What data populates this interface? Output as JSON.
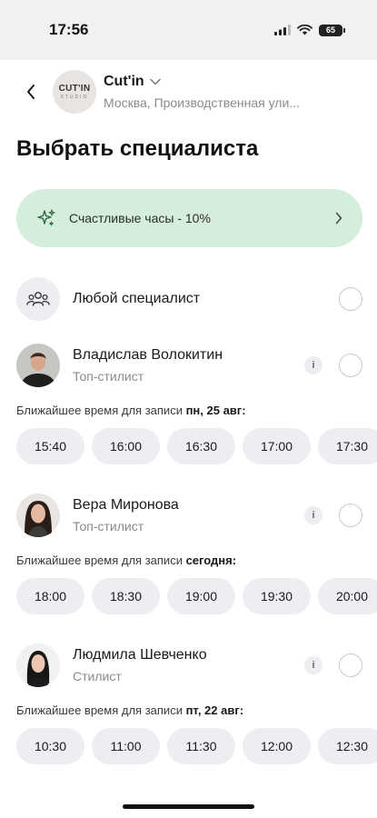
{
  "status": {
    "time": "17:56",
    "battery": "65"
  },
  "salon": {
    "logo_main": "CUT'IN",
    "logo_sub": "STUDIO",
    "name": "Cut'in",
    "address": "Москва, Производственная ули..."
  },
  "page_title": "Выбрать специалиста",
  "promo": {
    "label": "Счастливые часы - 10%"
  },
  "any_specialist": {
    "label": "Любой специалист"
  },
  "nearest_prefix": "Ближайшее время для записи",
  "masters": [
    {
      "name": "Владислав Волокитин",
      "role": "Топ-стилист",
      "nearest_date": "пн, 25 авг:",
      "slots": [
        "15:40",
        "16:00",
        "16:30",
        "17:00",
        "17:30"
      ]
    },
    {
      "name": "Вера Миронова",
      "role": "Топ-стилист",
      "nearest_date": "сегодня:",
      "slots": [
        "18:00",
        "18:30",
        "19:00",
        "19:30",
        "20:00"
      ]
    },
    {
      "name": "Людмила Шевченко",
      "role": "Стилист",
      "nearest_date": "пт, 22 авг:",
      "slots": [
        "10:30",
        "11:00",
        "11:30",
        "12:00",
        "12:30"
      ]
    }
  ],
  "info_icon": "i"
}
